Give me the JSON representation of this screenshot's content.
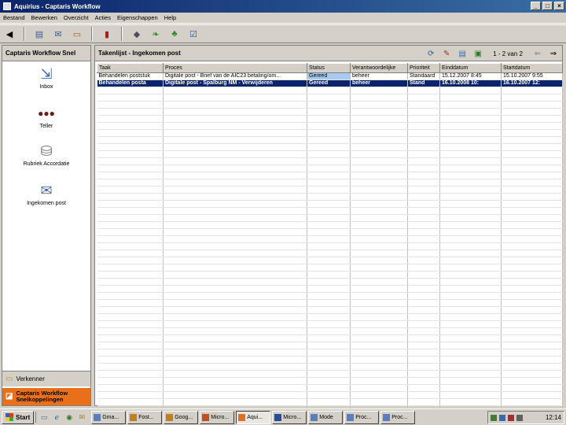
{
  "window": {
    "title": "Aquirius - Captaris Workflow",
    "controls": [
      "_",
      "□",
      "×"
    ]
  },
  "menu": [
    "Bestand",
    "Bewerken",
    "Overzicht",
    "Acties",
    "Eigenschappen",
    "Help"
  ],
  "toolbar_icons": [
    "back-icon",
    "document-icon",
    "mail-icon",
    "folder-icon",
    "book-icon",
    "gift-icon",
    "leaf-icon",
    "flask-icon",
    "check-icon"
  ],
  "left_panel": {
    "title": "Captaris Workflow Snel",
    "items": [
      {
        "label": "Inbox",
        "icon": "inbox-icon"
      },
      {
        "label": "Teller",
        "icon": "teller-icon"
      },
      {
        "label": "Rubriek Accordatie",
        "icon": "database-icon"
      },
      {
        "label": "Ingekomen post",
        "icon": "envelope-icon"
      }
    ],
    "bottom": [
      {
        "label": "Verkenner",
        "icon": "folder-icon"
      },
      {
        "label": "Captaris Workflow Snelkoppelingen",
        "icon": "shortcut-icon"
      }
    ]
  },
  "right_panel": {
    "title": "Takenlijst - Ingekomen post",
    "pager": "1 - 2 van 2",
    "columns": [
      "Taak",
      "Proces",
      "Status",
      "Verantwoordelijke",
      "Prioriteit",
      "Einddatum",
      "Startdatum"
    ],
    "rows": [
      [
        "Behandelen poststuk",
        "Digitale post - Brief van de AIC23 betaling/om...",
        "Gereed",
        "beheer",
        "Standaard",
        "15.12.2007 8:45",
        "15.10.2007 9:55"
      ],
      [
        "Behandelen posta",
        "Digitale post - Spalburg NM - Verwijderen",
        "Gereed",
        "beheer",
        "Stand",
        "16.10.2008 10:",
        "16.10.2007 12:"
      ]
    ],
    "selected_row": 1
  },
  "taskbar": {
    "start": "Start",
    "tasks": [
      "Gma...",
      "Fost...",
      "Goog...",
      "Micro...",
      "Aqui...",
      "Micro...",
      "Mode",
      "Proc...",
      "Proc..."
    ],
    "active_task": 4,
    "clock": "12:14"
  },
  "colors": {
    "titlebar": "#0a246a",
    "selection": "#0a246a",
    "status_highlight": "#a6caf0",
    "shortcut_bar": "#e8701a"
  }
}
